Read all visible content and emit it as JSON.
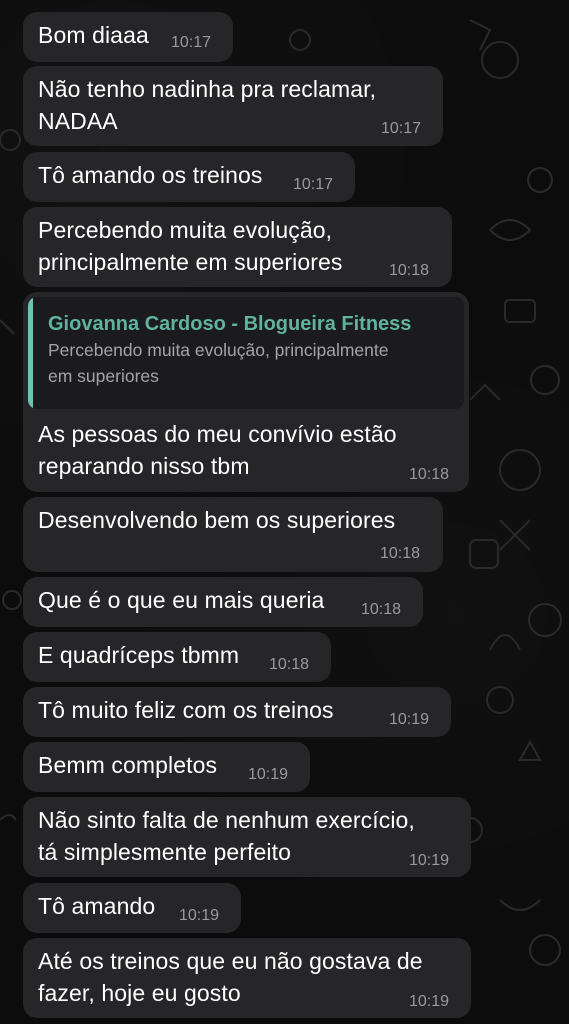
{
  "chat": {
    "messages": [
      {
        "lines": [
          "Bom diaaa"
        ],
        "time": "10:17"
      },
      {
        "lines": [
          "Não tenho nadinha pra reclamar,",
          "NADAA"
        ],
        "time": "10:17"
      },
      {
        "lines": [
          "Tô amando os treinos"
        ],
        "time": "10:17"
      },
      {
        "lines": [
          "Percebendo muita evolução,",
          "principalmente em superiores"
        ],
        "time": "10:18"
      },
      {
        "quote": {
          "author": "Giovanna Cardoso - Blogueira Fitness",
          "lines": [
            "Percebendo muita evolução, principalmente",
            "em superiores"
          ]
        },
        "lines": [
          "As pessoas do meu convívio estão",
          "reparando nisso tbm"
        ],
        "time": "10:18"
      },
      {
        "lines": [
          "Desenvolvendo bem os superiores"
        ],
        "time": "10:18"
      },
      {
        "lines": [
          "Que é o que eu mais queria"
        ],
        "time": "10:18"
      },
      {
        "lines": [
          "E quadríceps tbmm"
        ],
        "time": "10:18"
      },
      {
        "lines": [
          "Tô muito feliz com os treinos"
        ],
        "time": "10:19"
      },
      {
        "lines": [
          "Bemm completos"
        ],
        "time": "10:19"
      },
      {
        "lines": [
          "Não sinto falta de nenhum exercício,",
          "tá simplesmente perfeito"
        ],
        "time": "10:19"
      },
      {
        "lines": [
          "Tô amando"
        ],
        "time": "10:19"
      },
      {
        "lines": [
          "Até os treinos que eu não gostava de",
          "fazer, hoje eu gosto"
        ],
        "time": "10:19"
      }
    ]
  },
  "theme": {
    "bubble_color": "#262628",
    "quote_accent": "#5fb39f",
    "background": "#0c0c0c"
  }
}
